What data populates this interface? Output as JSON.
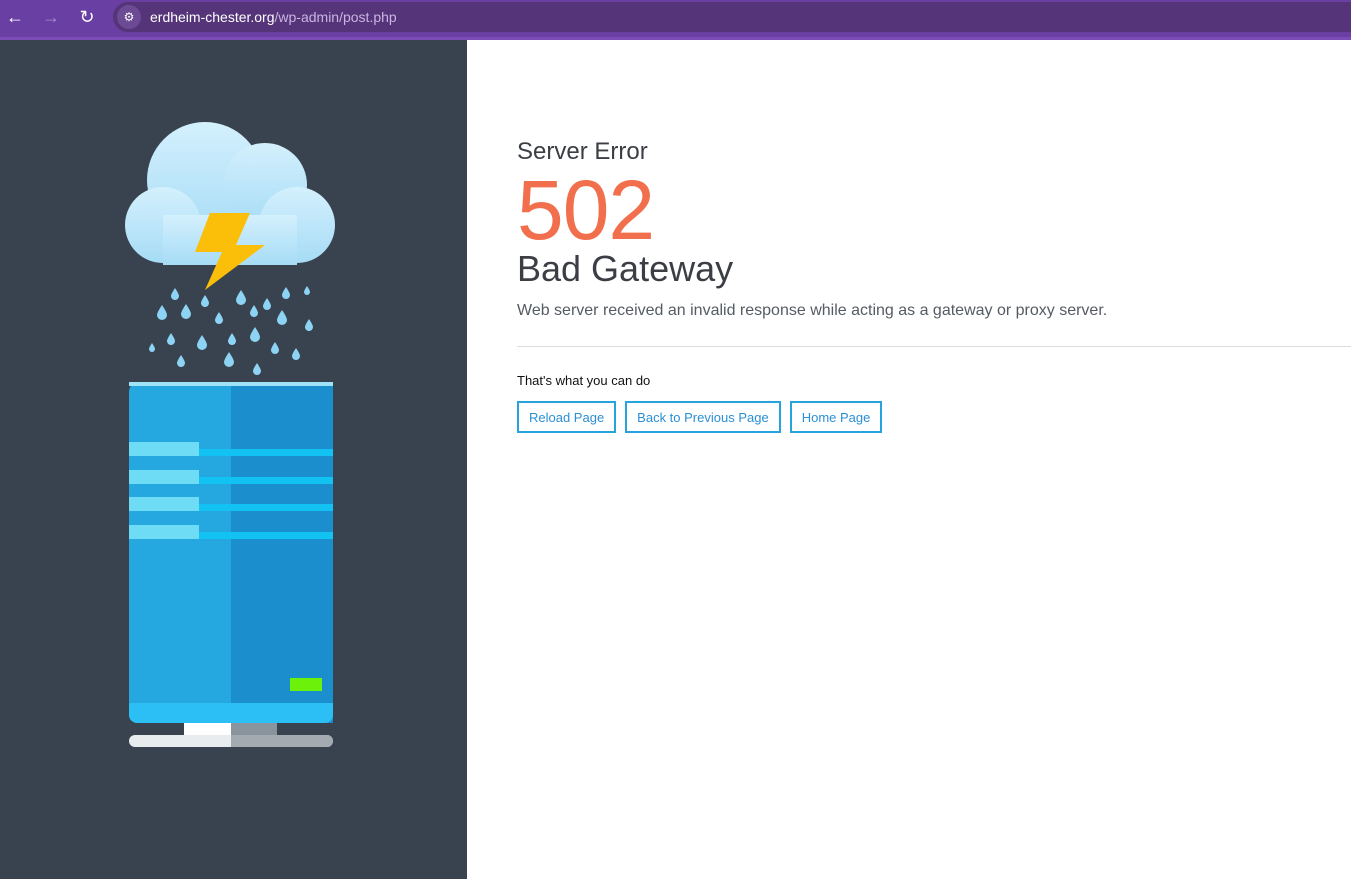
{
  "browser": {
    "url_domain": "erdheim-chester.org",
    "url_path": "/wp-admin/post.php"
  },
  "error": {
    "kicker": "Server Error",
    "code": "502",
    "title": "Bad Gateway",
    "description": "Web server received an invalid response while acting as a gateway or proxy server.",
    "actions_heading": "That's what you can do",
    "buttons": [
      "Reload Page",
      "Back to Previous Page",
      "Home Page"
    ]
  },
  "colors": {
    "accent": "#f26f4d",
    "button": "#27a3dd",
    "panel": "#39434f"
  }
}
